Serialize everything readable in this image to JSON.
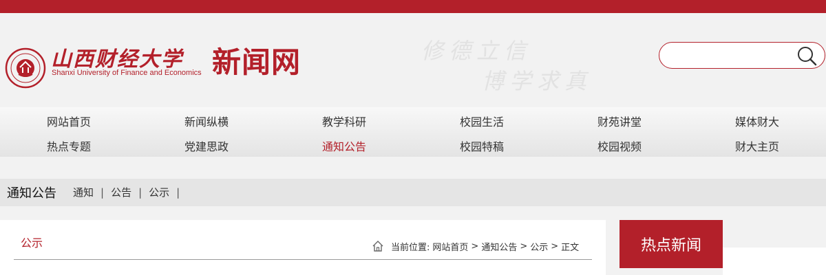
{
  "header": {
    "logo_cn": "山西财经大学",
    "logo_en": "Shanxi University  of Finance and Economics",
    "site_name": "新闻网",
    "motto_line1": "修德立信",
    "motto_line2": "博学求真"
  },
  "search": {
    "placeholder": "",
    "value": "",
    "icon": "search-icon"
  },
  "nav": {
    "row1": [
      "网站首页",
      "新闻纵横",
      "教学科研",
      "校园生活",
      "财苑讲堂",
      "媒体财大"
    ],
    "row2": [
      "热点专题",
      "党建思政",
      "通知公告",
      "校园特稿",
      "校园视频",
      "财大主页"
    ],
    "active": "通知公告"
  },
  "section": {
    "title": "通知公告",
    "links": [
      "通知",
      "公告",
      "公示"
    ]
  },
  "content": {
    "title": "公示",
    "breadcrumb_label": "当前位置:",
    "breadcrumb": [
      "网站首页",
      "通知公告",
      "公示",
      "正文"
    ]
  },
  "sidebar": {
    "hot_title": "热点新闻"
  },
  "colors": {
    "brand": "#b3202a",
    "background": "#f2f2f2",
    "nav_bar": "#e5e5e5"
  }
}
